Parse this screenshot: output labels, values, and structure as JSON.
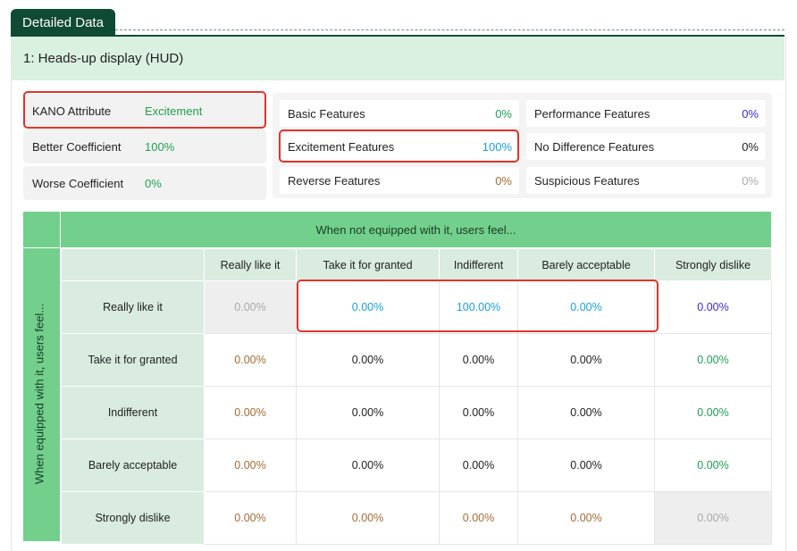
{
  "tab_label": "Detailed Data",
  "section_title": "1: Heads-up display (HUD)",
  "attributes": [
    {
      "label": "KANO Attribute",
      "value": "Excitement"
    },
    {
      "label": "Better Coefficient",
      "value": "100%"
    },
    {
      "label": "Worse Coefficient",
      "value": "0%"
    }
  ],
  "features": [
    {
      "label": "Basic Features",
      "value": "0%",
      "color": "#1e9f55"
    },
    {
      "label": "Performance Features",
      "value": "0%",
      "color": "#3b2bd4"
    },
    {
      "label": "Excitement Features",
      "value": "100%",
      "color": "#1aa0e0"
    },
    {
      "label": "No Difference Features",
      "value": "0%",
      "color": "#222222"
    },
    {
      "label": "Reverse Features",
      "value": "0%",
      "color": "#a76b33"
    },
    {
      "label": "Suspicious Features",
      "value": "0%",
      "color": "#aaaaaa"
    }
  ],
  "matrix": {
    "top_title": "When not equipped with it, users feel...",
    "side_title": "When equipped with it, users feel...",
    "columns": [
      "Really like it",
      "Take it for granted",
      "Indifferent",
      "Barely acceptable",
      "Strongly dislike"
    ],
    "rows": [
      {
        "label": "Really like it",
        "cells": [
          "0.00%",
          "0.00%",
          "100.00%",
          "0.00%",
          "0.00%"
        ]
      },
      {
        "label": "Take it for granted",
        "cells": [
          "0.00%",
          "0.00%",
          "0.00%",
          "0.00%",
          "0.00%"
        ]
      },
      {
        "label": "Indifferent",
        "cells": [
          "0.00%",
          "0.00%",
          "0.00%",
          "0.00%",
          "0.00%"
        ]
      },
      {
        "label": "Barely acceptable",
        "cells": [
          "0.00%",
          "0.00%",
          "0.00%",
          "0.00%",
          "0.00%"
        ]
      },
      {
        "label": "Strongly dislike",
        "cells": [
          "0.00%",
          "0.00%",
          "0.00%",
          "0.00%",
          "0.00%"
        ]
      }
    ]
  }
}
